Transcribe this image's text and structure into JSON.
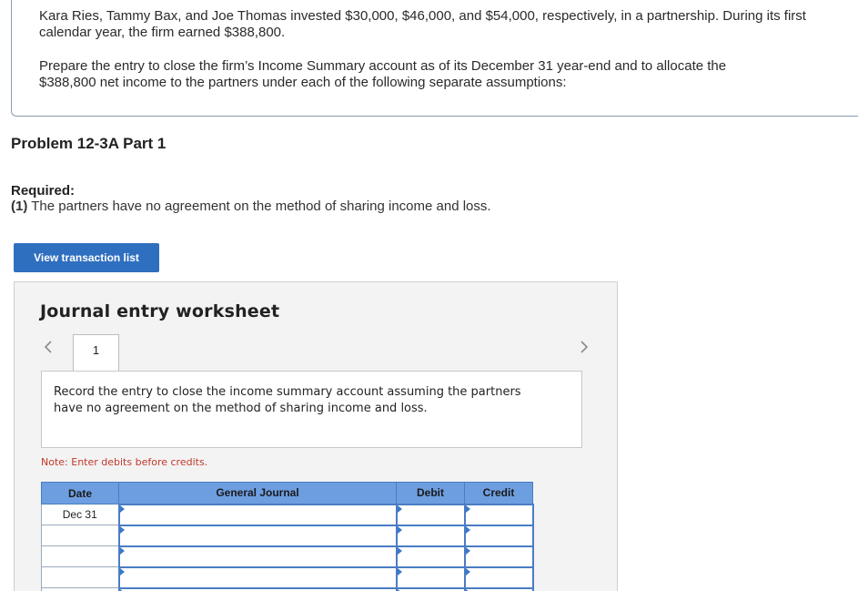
{
  "intro": {
    "paragraph1": "Kara Ries, Tammy Bax, and Joe Thomas invested $30,000, $46,000, and $54,000, respectively, in a partnership. During its first calendar year, the firm earned $388,800.",
    "paragraph2": "Prepare the entry to close the firm’s Income Summary account as of its December 31 year-end and to allocate the $388,800 net income to the partners under each of the following separate assumptions:"
  },
  "problem_title": "Problem 12-3A Part 1",
  "required": {
    "label": "Required:",
    "number": "(1)",
    "text": " The partners have no agreement on the method of sharing income and loss."
  },
  "view_button": "View transaction list",
  "worksheet": {
    "title": "Journal entry worksheet",
    "tab_label": "1",
    "instruction": "Record the entry to close the income summary account assuming the partners have no agreement on the method of sharing income and loss.",
    "note": "Note: Enter debits before credits.",
    "columns": {
      "date": "Date",
      "general_journal": "General Journal",
      "debit": "Debit",
      "credit": "Credit"
    },
    "rows": [
      {
        "date": "Dec 31"
      },
      {
        "date": ""
      },
      {
        "date": ""
      },
      {
        "date": ""
      },
      {
        "date": ""
      }
    ]
  },
  "colors": {
    "button_blue": "#2f6fbf",
    "header_blue": "#6d9ee0",
    "note_red": "#c0392b"
  },
  "icons": {
    "prev": "chevron-left-icon",
    "next": "chevron-right-icon"
  }
}
